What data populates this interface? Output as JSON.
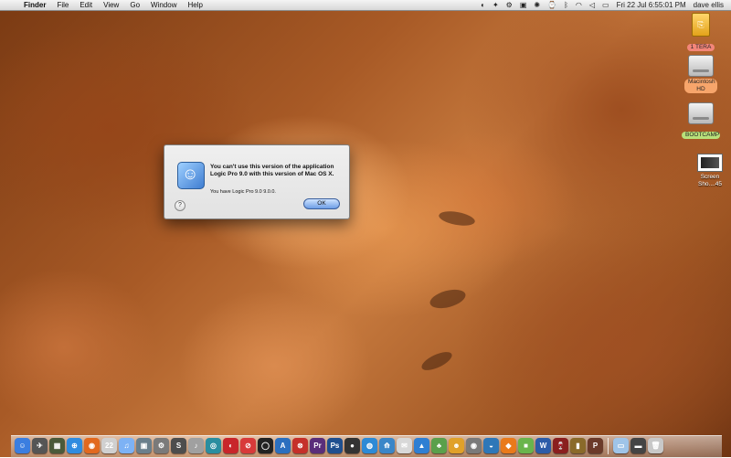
{
  "menubar": {
    "apple": "",
    "menus": [
      "Finder",
      "File",
      "Edit",
      "View",
      "Go",
      "Window",
      "Help"
    ],
    "clock": "Fri 22 Jul  6:55:01 PM",
    "user": "dave ellis"
  },
  "desktop_icons": [
    {
      "label": "1 TERA",
      "kind": "usb"
    },
    {
      "label": "Macintosh HD",
      "kind": "drive"
    },
    {
      "label": "BOOTCAMP",
      "kind": "drive"
    },
    {
      "label": "Screen Sho....45",
      "kind": "screenshot"
    }
  ],
  "dialog": {
    "title": "You can't use this version of the application Logic Pro 9.0 with this version of Mac OS X.",
    "message": "You have Logic Pro 9.0 9.0.0.",
    "help": "?",
    "ok": "OK"
  },
  "dock": {
    "items": [
      {
        "name": "finder",
        "color": "#3b7ee0",
        "glyph": "☺"
      },
      {
        "name": "launchpad",
        "color": "#555555",
        "glyph": "✈"
      },
      {
        "name": "mission-control",
        "color": "#4a5a3a",
        "glyph": "▦"
      },
      {
        "name": "safari",
        "color": "#2f8ce0",
        "glyph": "⊕"
      },
      {
        "name": "firefox",
        "color": "#e2691f",
        "glyph": "◉"
      },
      {
        "name": "ical",
        "color": "#d0d0d0",
        "glyph": "22"
      },
      {
        "name": "itunes",
        "color": "#7db2f5",
        "glyph": "♫"
      },
      {
        "name": "iphoto",
        "color": "#6a7f8c",
        "glyph": "▣"
      },
      {
        "name": "system-prefs",
        "color": "#7a7a7a",
        "glyph": "⚙"
      },
      {
        "name": "app-s",
        "color": "#4d4d4d",
        "glyph": "S"
      },
      {
        "name": "garageband",
        "color": "#a0a0a0",
        "glyph": "♪"
      },
      {
        "name": "app-spiral",
        "color": "#2a8ea0",
        "glyph": "◎"
      },
      {
        "name": "app-red-1",
        "color": "#c8262b",
        "glyph": "◐"
      },
      {
        "name": "app-red-2",
        "color": "#d83a3a",
        "glyph": "⊘"
      },
      {
        "name": "app-ring",
        "color": "#222222",
        "glyph": "◯"
      },
      {
        "name": "app-blue-a",
        "color": "#2b6fbf",
        "glyph": "A"
      },
      {
        "name": "app-red-3",
        "color": "#c5302a",
        "glyph": "⊗"
      },
      {
        "name": "premiere",
        "color": "#5a2e7a",
        "glyph": "Pr"
      },
      {
        "name": "photoshop",
        "color": "#1f4f8f",
        "glyph": "Ps"
      },
      {
        "name": "app-dark",
        "color": "#333333",
        "glyph": "●"
      },
      {
        "name": "app-globe",
        "color": "#2d8ad6",
        "glyph": "◍"
      },
      {
        "name": "app-fish",
        "color": "#3a86c8",
        "glyph": "⟰"
      },
      {
        "name": "app-mail",
        "color": "#d8d8d8",
        "glyph": "✉"
      },
      {
        "name": "app-bird",
        "color": "#2f7fd3",
        "glyph": "▲"
      },
      {
        "name": "app-tree",
        "color": "#5aa04b",
        "glyph": "♣"
      },
      {
        "name": "app-people",
        "color": "#e0a12a",
        "glyph": "☻"
      },
      {
        "name": "app-round",
        "color": "#7a7a7a",
        "glyph": "◉"
      },
      {
        "name": "app-earth",
        "color": "#2e77b8",
        "glyph": "◒"
      },
      {
        "name": "app-orange",
        "color": "#e97a1b",
        "glyph": "◆"
      },
      {
        "name": "app-green-cube",
        "color": "#69b54c",
        "glyph": "■"
      },
      {
        "name": "app-w",
        "color": "#2c5ca8",
        "glyph": "W"
      },
      {
        "name": "app-wine",
        "color": "#8a1f1f",
        "glyph": "🍷"
      },
      {
        "name": "app-spray",
        "color": "#8a6a2a",
        "glyph": "▮"
      },
      {
        "name": "app-p",
        "color": "#6b3a2a",
        "glyph": "P"
      },
      {
        "name": "app-folder",
        "color": "#9fc4e8",
        "glyph": "▭"
      },
      {
        "name": "app-monitor",
        "color": "#444444",
        "glyph": "▬"
      },
      {
        "name": "trash",
        "color": "#c8c8c8",
        "glyph": "🗑"
      }
    ]
  },
  "colors": {
    "menubar": "#e6e6e6",
    "dialog_bg": "#e8e8e8",
    "ok_button": "#6d9de6"
  }
}
